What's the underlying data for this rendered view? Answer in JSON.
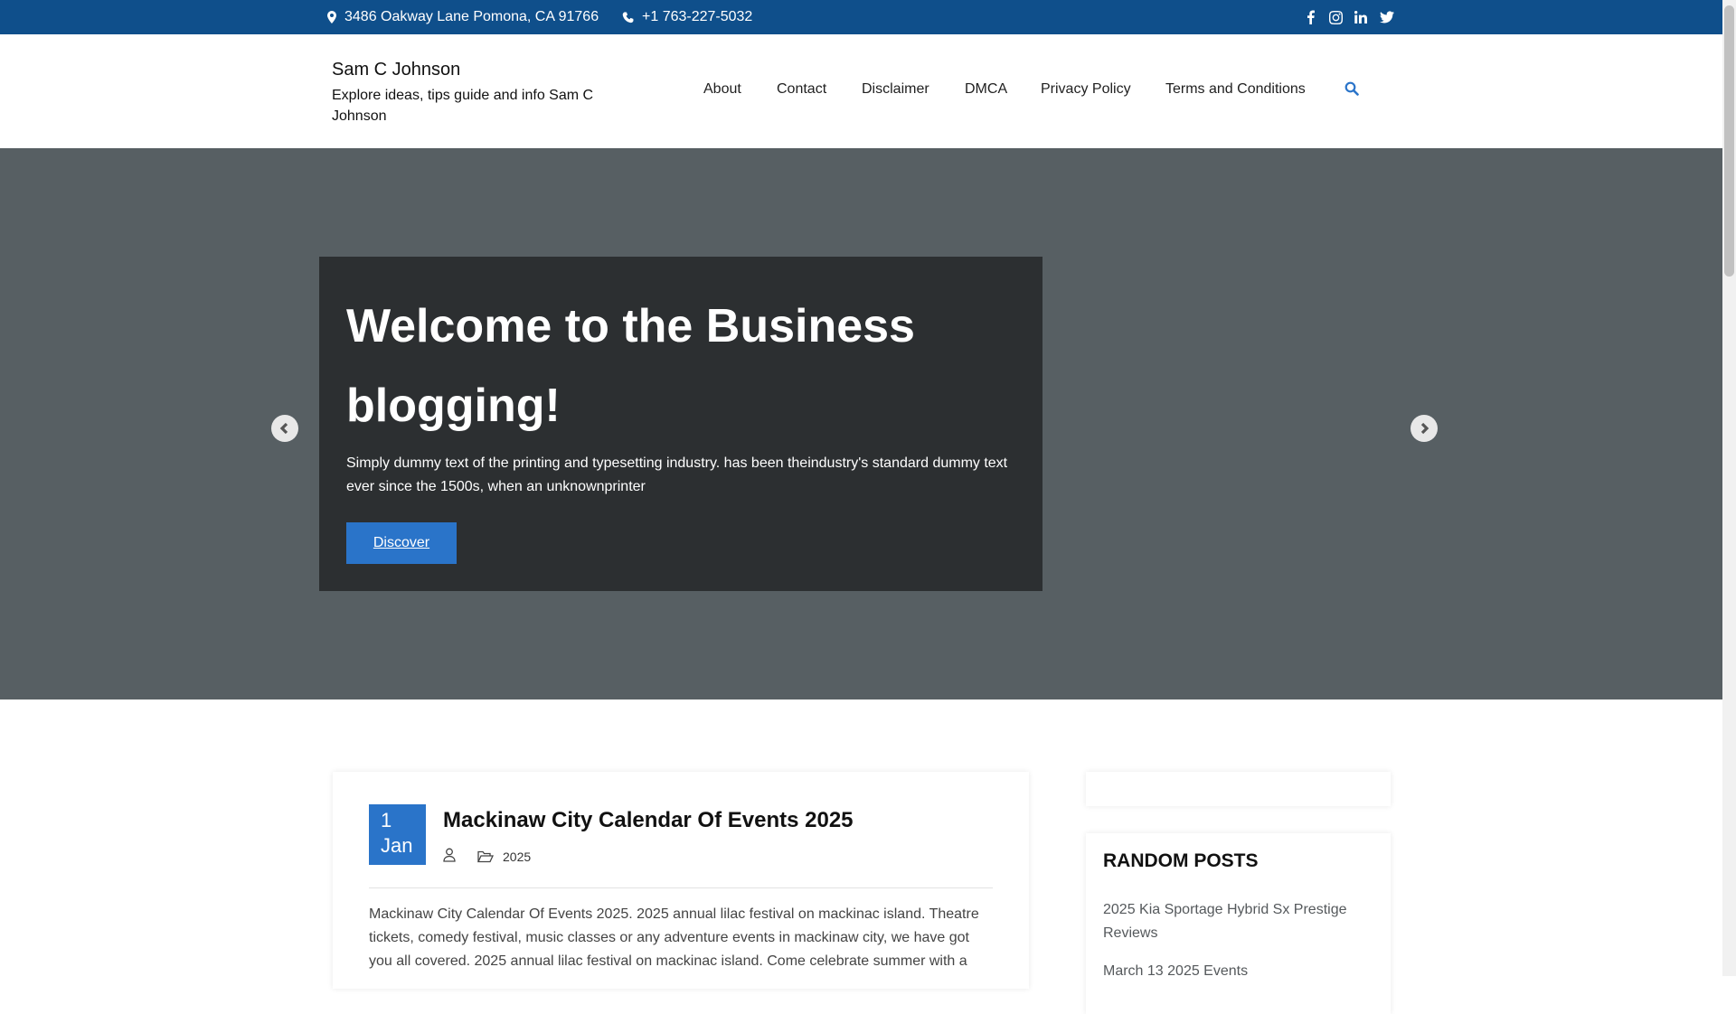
{
  "topbar": {
    "address": "3486 Oakway Lane Pomona, CA 91766",
    "phone": "+1 763-227-5032",
    "social": [
      "facebook-icon",
      "instagram-icon",
      "linkedin-icon",
      "twitter-icon"
    ]
  },
  "header": {
    "site_title": "Sam C Johnson",
    "tagline": "Explore ideas, tips guide and info Sam C Johnson",
    "nav": [
      "About",
      "Contact",
      "Disclaimer",
      "DMCA",
      "Privacy Policy",
      "Terms and Conditions"
    ]
  },
  "hero": {
    "title": "Welcome to the Business blogging!",
    "description": "Simply dummy text of the printing and typesetting industry. has been theindustry's standard dummy text ever since the 1500s, when an unknownprinter",
    "button": "Discover"
  },
  "post": {
    "date_day": "1",
    "date_month": "Jan",
    "title": "Mackinaw City Calendar Of Events 2025",
    "category": "2025",
    "excerpt": "Mackinaw City Calendar Of Events 2025. 2025 annual lilac festival on mackinac island. Theatre tickets, comedy festival, music classes or any adventure events in mackinaw city, we have got you all covered. 2025 annual lilac festival on mackinac island. Come celebrate summer with a"
  },
  "sidebar": {
    "random_title": "RANDOM POSTS",
    "random_posts": [
      "2025 Kia Sportage Hybrid Sx Prestige Reviews",
      "March 13 2025 Events"
    ]
  },
  "colors": {
    "topbar_bg": "#0f4f8b",
    "accent": "#2a74c9",
    "hero_bg": "#575f63",
    "hero_box_bg": "#2c2f31"
  }
}
